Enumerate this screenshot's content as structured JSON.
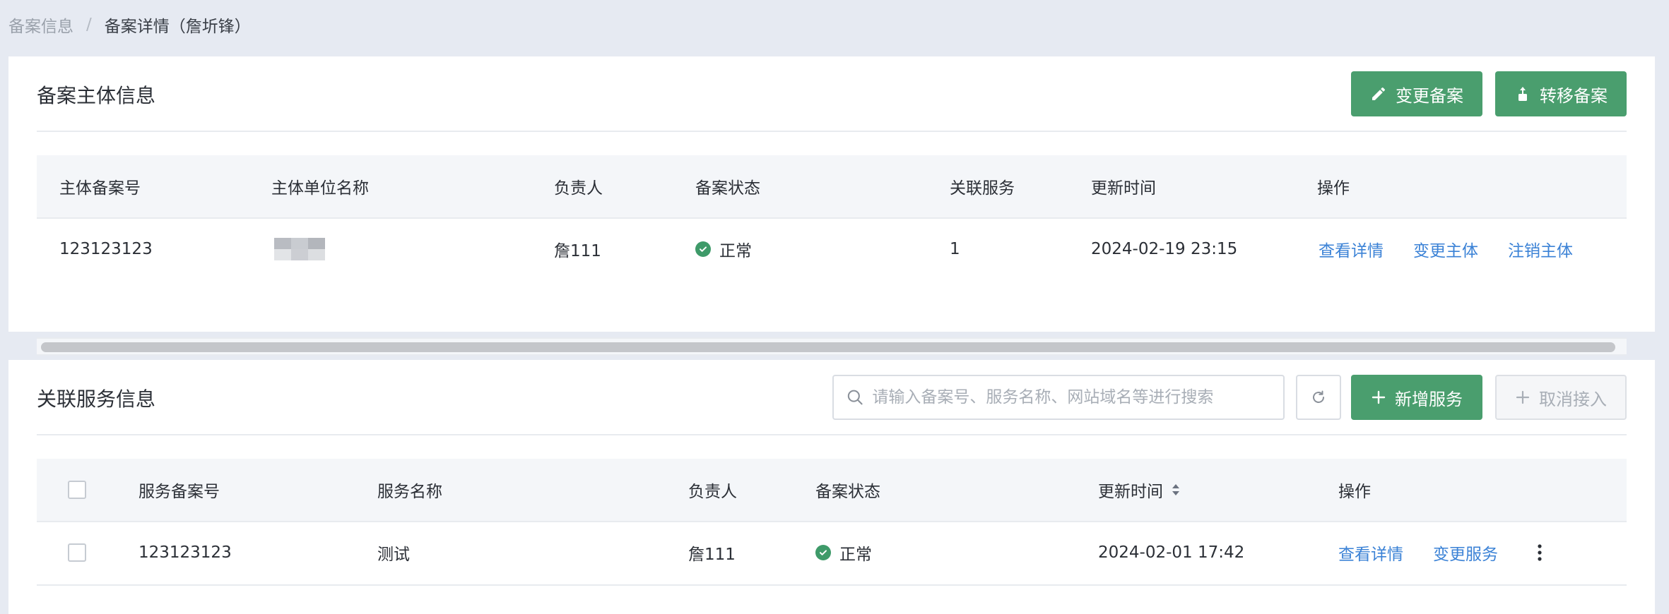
{
  "breadcrumb": {
    "parent": "备案信息",
    "separator": "/",
    "current": "备案详情（詹圻锋）"
  },
  "entity_section": {
    "title": "备案主体信息",
    "buttons": {
      "change": "变更备案",
      "transfer": "转移备案"
    },
    "columns": [
      "主体备案号",
      "主体单位名称",
      "负责人",
      "备案状态",
      "关联服务",
      "更新时间",
      "操作"
    ],
    "row": {
      "record_no": "123123123",
      "unit_name": "",
      "owner": "詹111",
      "status": "正常",
      "services": "1",
      "updated": "2024-02-19 23:15",
      "actions": [
        "查看详情",
        "变更主体",
        "注销主体"
      ]
    }
  },
  "service_section": {
    "title": "关联服务信息",
    "search": {
      "placeholder": "请输入备案号、服务名称、网站域名等进行搜索",
      "value": ""
    },
    "buttons": {
      "add": "新增服务",
      "cancel": "取消接入"
    },
    "columns": [
      "服务备案号",
      "服务名称",
      "负责人",
      "备案状态",
      "更新时间",
      "操作"
    ],
    "row": {
      "record_no": "123123123",
      "name": "测试",
      "owner": "詹111",
      "status": "正常",
      "updated": "2024-02-01 17:42",
      "actions": [
        "查看详情",
        "变更服务"
      ]
    }
  },
  "colors": {
    "primary": "#4a9e6e",
    "link": "#3b82d6",
    "status_ok": "#3e9a69",
    "background": "#e6eaf2"
  }
}
